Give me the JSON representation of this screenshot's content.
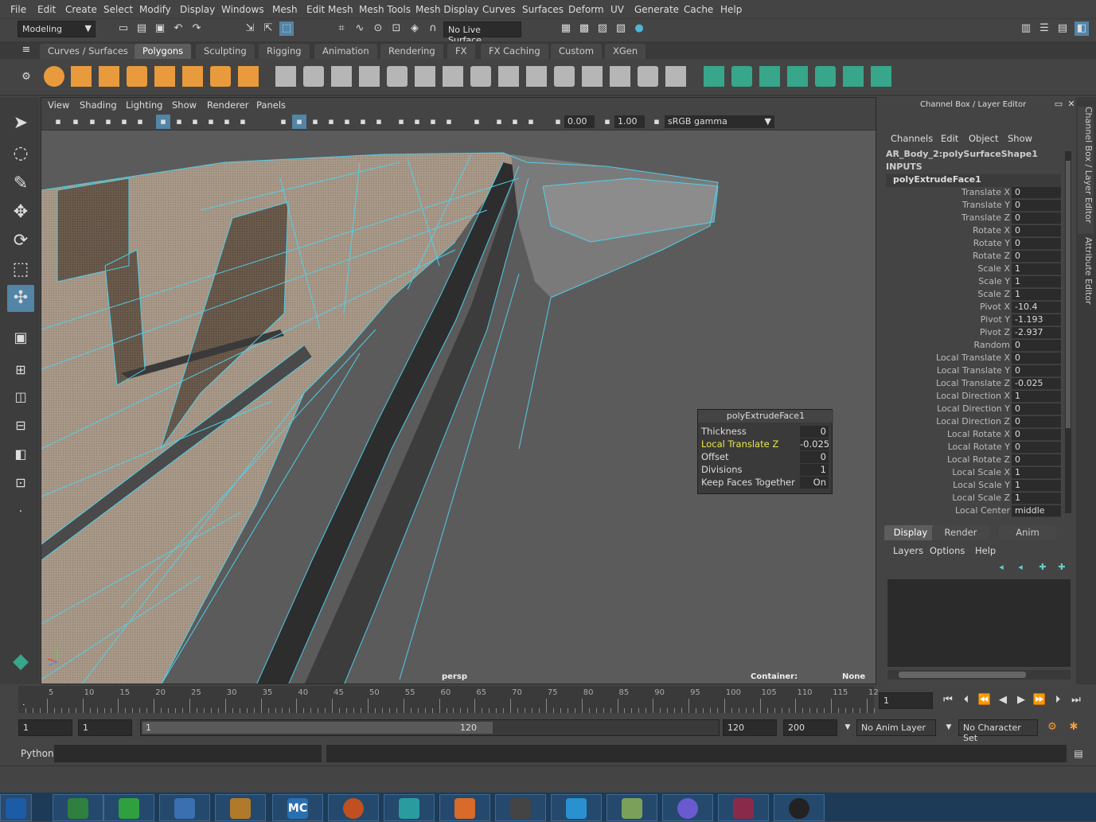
{
  "menu": [
    "File",
    "Edit",
    "Create",
    "Select",
    "Modify",
    "Display",
    "Windows",
    "Mesh",
    "Edit Mesh",
    "Mesh Tools",
    "Mesh Display",
    "Curves",
    "Surfaces",
    "Deform",
    "UV",
    "Generate",
    "Cache",
    "Help"
  ],
  "status": {
    "mode": "Modeling",
    "live_surface": "No Live Surface"
  },
  "shelf_tabs": [
    "Curves / Surfaces",
    "Polygons",
    "Sculpting",
    "Rigging",
    "Animation",
    "Rendering",
    "FX",
    "FX Caching",
    "Custom",
    "XGen"
  ],
  "shelf_active": "Polygons",
  "viewport": {
    "menu": [
      "View",
      "Shading",
      "Lighting",
      "Show",
      "Renderer",
      "Panels"
    ],
    "exposure": "0.00",
    "gamma": "1.00",
    "color_space": "sRGB gamma",
    "camera_label": "persp",
    "container_label": "Container:",
    "container_value": "None"
  },
  "popup": {
    "title": "polyExtrudeFace1",
    "rows": [
      {
        "label": "Thickness",
        "value": "0",
        "highlight": false
      },
      {
        "label": "Local Translate Z",
        "value": "-0.025",
        "highlight": true
      },
      {
        "label": "Offset",
        "value": "0",
        "highlight": false
      },
      {
        "label": "Divisions",
        "value": "1",
        "highlight": false
      },
      {
        "label": "Keep Faces Together",
        "value": "On",
        "highlight": false
      }
    ]
  },
  "channel_box": {
    "title": "Channel Box / Layer Editor",
    "menu": [
      "Channels",
      "Edit",
      "Object",
      "Show"
    ],
    "object": "AR_Body_2:polySurfaceShape1",
    "inputs_label": "INPUTS",
    "node": "polyExtrudeFace1",
    "attrs": [
      {
        "name": "Translate X",
        "value": "0"
      },
      {
        "name": "Translate Y",
        "value": "0"
      },
      {
        "name": "Translate Z",
        "value": "0"
      },
      {
        "name": "Rotate X",
        "value": "0"
      },
      {
        "name": "Rotate Y",
        "value": "0"
      },
      {
        "name": "Rotate Z",
        "value": "0"
      },
      {
        "name": "Scale X",
        "value": "1"
      },
      {
        "name": "Scale Y",
        "value": "1"
      },
      {
        "name": "Scale Z",
        "value": "1"
      },
      {
        "name": "Pivot X",
        "value": "-10.4"
      },
      {
        "name": "Pivot Y",
        "value": "-1.193"
      },
      {
        "name": "Pivot Z",
        "value": "-2.937"
      },
      {
        "name": "Random",
        "value": "0"
      },
      {
        "name": "Local Translate X",
        "value": "0"
      },
      {
        "name": "Local Translate Y",
        "value": "0"
      },
      {
        "name": "Local Translate Z",
        "value": "-0.025"
      },
      {
        "name": "Local Direction X",
        "value": "1"
      },
      {
        "name": "Local Direction Y",
        "value": "0"
      },
      {
        "name": "Local Direction Z",
        "value": "0"
      },
      {
        "name": "Local Rotate X",
        "value": "0"
      },
      {
        "name": "Local Rotate Y",
        "value": "0"
      },
      {
        "name": "Local Rotate Z",
        "value": "0"
      },
      {
        "name": "Local Scale X",
        "value": "1"
      },
      {
        "name": "Local Scale Y",
        "value": "1"
      },
      {
        "name": "Local Scale Z",
        "value": "1"
      },
      {
        "name": "Local Center",
        "value": "middle"
      }
    ]
  },
  "layer_editor": {
    "tabs": [
      "Display",
      "Render",
      "Anim"
    ],
    "menu": [
      "Layers",
      "Options",
      "Help"
    ]
  },
  "side_tabs": [
    "Channel Box / Layer Editor",
    "Attribute Editor"
  ],
  "timeline": {
    "ticks": [
      "1",
      "5",
      "10",
      "15",
      "20",
      "25",
      "30",
      "35",
      "40",
      "45",
      "50",
      "55",
      "60",
      "65",
      "70",
      "75",
      "80",
      "85",
      "90",
      "95",
      "100",
      "105",
      "110",
      "115",
      "12"
    ],
    "current_frame": "1"
  },
  "range": {
    "start": "1",
    "playback_start": "1",
    "slider_start": "1",
    "slider_end": "120",
    "playback_end": "120",
    "end": "200",
    "anim_layer": "No Anim Layer",
    "char_set": "No Character Set"
  },
  "command_line": {
    "lang": "Python"
  },
  "taskbar": [
    {
      "name": "start",
      "label": ""
    },
    {
      "name": "chrome",
      "label": ""
    },
    {
      "name": "utorrent",
      "label": ""
    },
    {
      "name": "word",
      "label": ""
    },
    {
      "name": "app5",
      "label": ""
    },
    {
      "name": "mc",
      "label": "MC"
    },
    {
      "name": "app7",
      "label": ""
    },
    {
      "name": "maya",
      "label": ""
    },
    {
      "name": "fusion",
      "label": ""
    },
    {
      "name": "app10",
      "label": ""
    },
    {
      "name": "telegram",
      "label": ""
    },
    {
      "name": "app12",
      "label": ""
    },
    {
      "name": "discord",
      "label": ""
    },
    {
      "name": "winrar",
      "label": ""
    },
    {
      "name": "obs",
      "label": ""
    }
  ],
  "colors": {
    "accent": "#5285a6",
    "wire": "#4fd3ee",
    "highlight_text": "#e8e84a",
    "orange_icon": "#e89a3c",
    "green_icon": "#37a68a"
  }
}
